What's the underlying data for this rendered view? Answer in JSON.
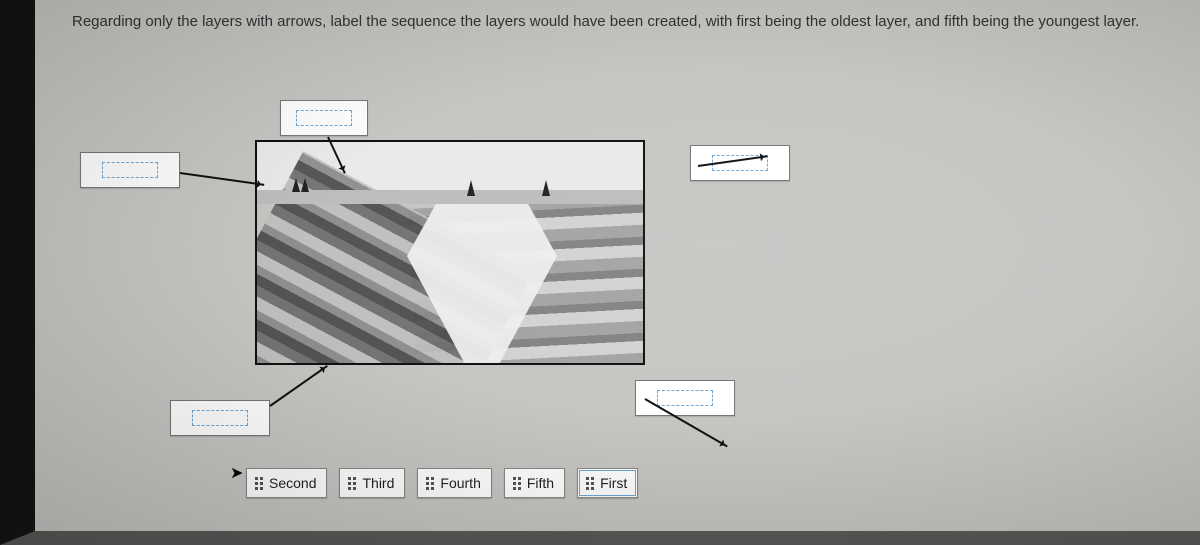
{
  "question": {
    "text": "Regarding only the layers with arrows, label the sequence the layers would have been created, with first being the oldest layer, and fifth being the youngest layer."
  },
  "answers": {
    "options": [
      {
        "label": "Second"
      },
      {
        "label": "Third"
      },
      {
        "label": "Fourth"
      },
      {
        "label": "Fifth"
      },
      {
        "label": "First"
      }
    ]
  },
  "drop_targets": [
    {
      "id": "a"
    },
    {
      "id": "b"
    },
    {
      "id": "c"
    },
    {
      "id": "d"
    },
    {
      "id": "e"
    }
  ]
}
